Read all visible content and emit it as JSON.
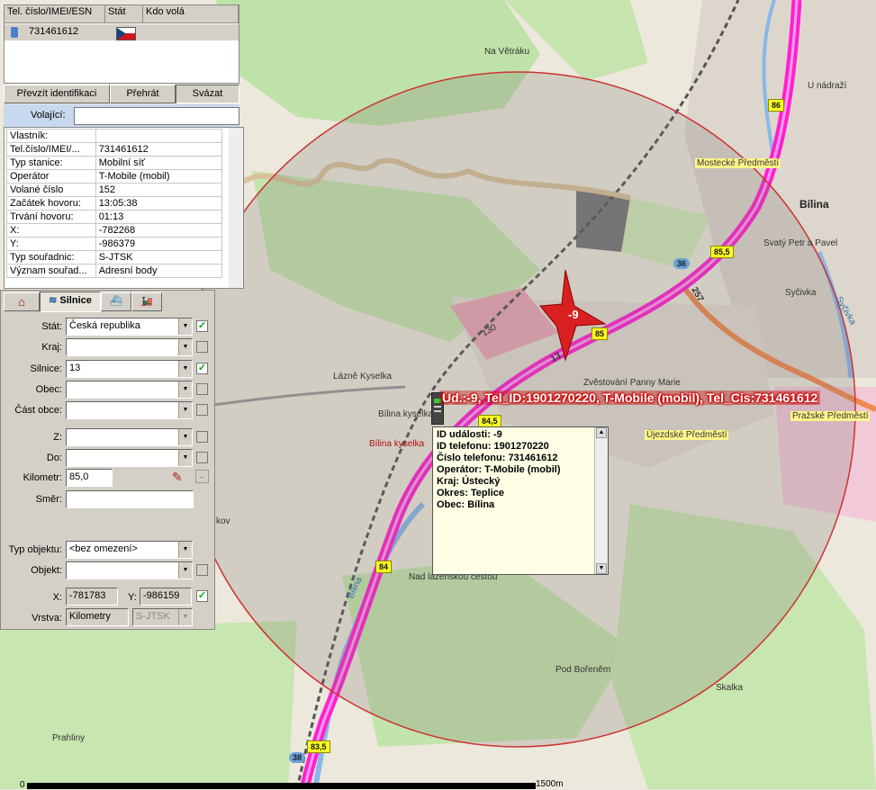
{
  "list": {
    "headers": [
      "Tel. číslo/IMEI/ESN",
      "Stát",
      "Kdo volá"
    ],
    "row": {
      "number": "731461612"
    }
  },
  "actions": {
    "takeover": "Převzít identifikaci",
    "play": "Přehrát",
    "bind": "Svázat"
  },
  "caller": {
    "label": "Volající:",
    "value": ""
  },
  "info_rows": [
    [
      "Vlastník:",
      ""
    ],
    [
      "Tel.číslo/IMEI/...",
      "731461612"
    ],
    [
      "Typ stanice:",
      "Mobilní síť"
    ],
    [
      "Operátor",
      "T-Mobile (mobil)"
    ],
    [
      "Volané číslo",
      "152"
    ],
    [
      "Začátek hovoru:",
      "13:05:38"
    ],
    [
      "Trvání hovoru:",
      "01:13"
    ],
    [
      "X:",
      "-782268"
    ],
    [
      "Y:",
      "-986379"
    ],
    [
      "Typ souřadnic:",
      "S-JTSK"
    ],
    [
      "Význam souřad...",
      "Adresní body"
    ]
  ],
  "tabs": {
    "roads": "Silnice"
  },
  "form": {
    "state_label": "Stát:",
    "state_value": "Česká republika",
    "region_label": "Kraj:",
    "region_value": "",
    "road_label": "Silnice:",
    "road_value": "13",
    "municipality_label": "Obec:",
    "municipality_value": "",
    "part_label": "Část obce:",
    "part_value": "",
    "from_label": "Z:",
    "from_value": "",
    "to_label": "Do:",
    "to_value": "",
    "km_label": "Kilometr:",
    "km_value": "85,0",
    "direction_label": "Směr:",
    "direction_value": "",
    "object_type_label": "Typ objektu:",
    "object_type_value": "<bez omezení>",
    "object_label": "Objekt:",
    "object_value": "",
    "x_label": "X:",
    "x_value": "-781783",
    "y_label": "Y:",
    "y_value": "-986159",
    "layer_label": "Vrstva:",
    "layer_value": "Kilometry",
    "coord_value": "S-JTSK"
  },
  "map": {
    "event_label": "Ud.:-9, Tel_ID:1901270220, T-Mobile (mobil), Tel_Cis:731461612",
    "marker_label": "-9",
    "popup": [
      "ID události:  -9",
      "ID telefonu:  1901270220",
      "Číslo telefonu:  731461612",
      "Operátor:  T-Mobile (mobil)",
      "Kraj:  Ústecký",
      "Okres:  Teplice",
      "Obec:  Bílina"
    ],
    "places": {
      "bilina": "Bílina",
      "mostecke": "Mostecké Předměstí",
      "prazske": "Pražské Předměstí",
      "ujezdske": "Újezdské Předměstí",
      "lazne": "Lázně Kyselka",
      "bilina_kyselka": "Bílina kyselka",
      "bilina_kyselka_red": "Bílina kyselka",
      "na_vetraku": "Na Větráku",
      "u_nadrazi": "U nádraží",
      "svaty_petr": "Svatý Petr a Pavel",
      "sycivka": "Syčivka",
      "sycivka2": "Syčivka",
      "zvestovani": "Zvěstování Panny Marie",
      "pod_borenem": "Pod Bořeněm",
      "skalka": "Skalka",
      "prahliny": "Prahliny",
      "nad_lazenskou": "Nad lázeňskou cestou",
      "bilina_river": "Bílina",
      "kov": "kov",
      "n130": "130",
      "n13": "13",
      "n257": "257"
    },
    "km_markers": [
      "86",
      "85,5",
      "85",
      "84,5",
      "84",
      "83,5"
    ],
    "road_badges": [
      "36",
      "38"
    ],
    "scale": {
      "zero": "0",
      "end": "1500m"
    }
  },
  "colors": {
    "road": "#ff20d0",
    "radius": "#cc3333",
    "panel": "#d4d0c8"
  }
}
